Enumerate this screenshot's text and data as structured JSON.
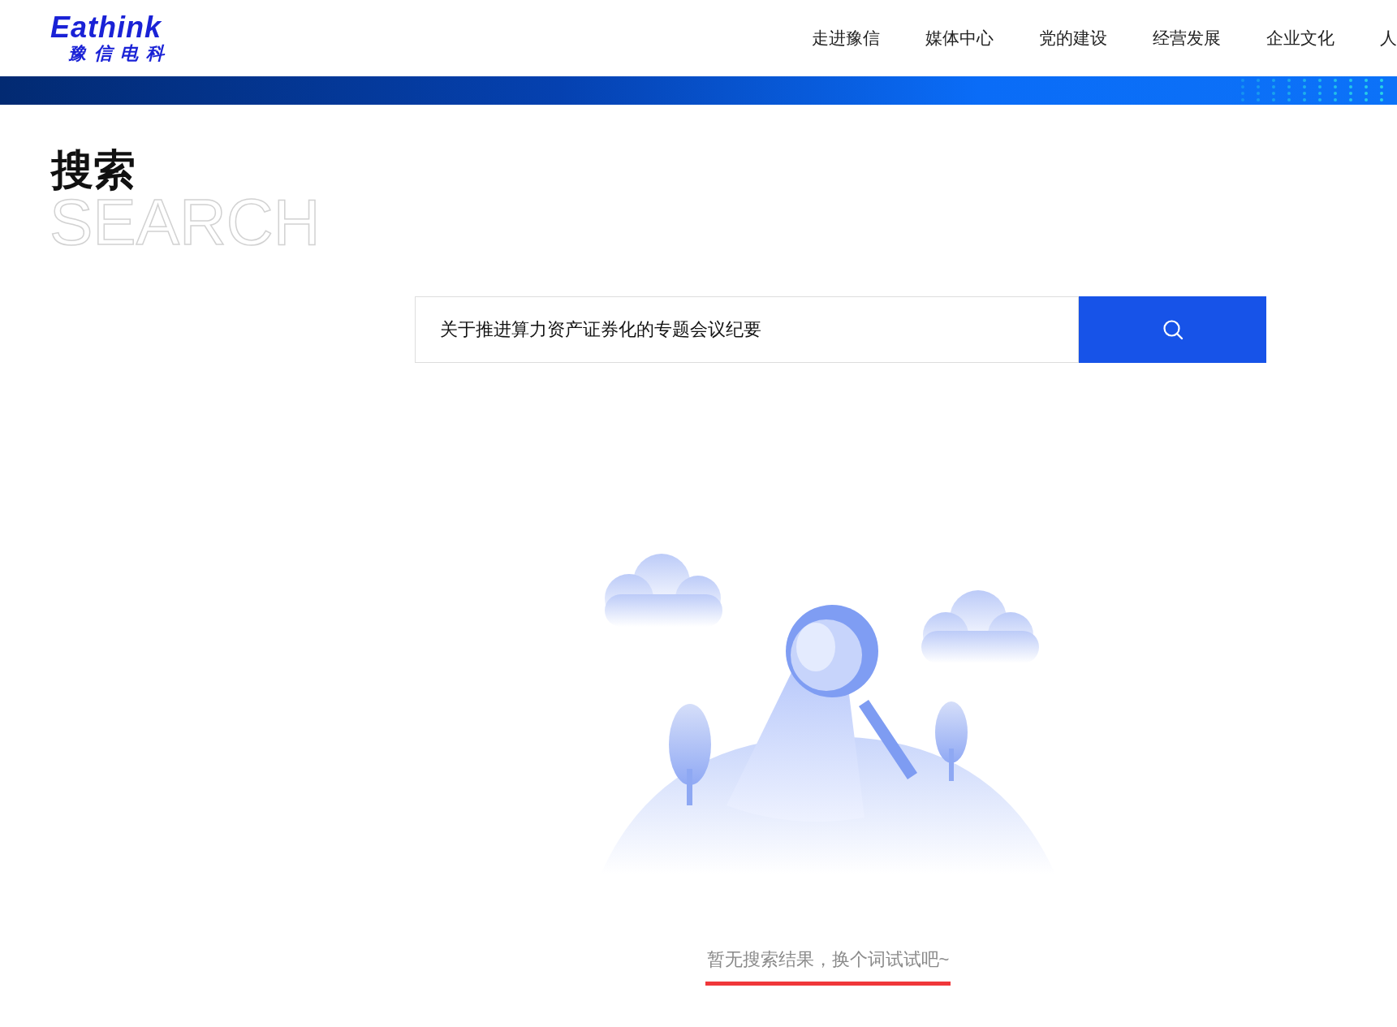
{
  "header": {
    "logo": {
      "wordmark": "Eathink",
      "name": "豫信电科"
    },
    "nav": [
      {
        "label": "走进豫信"
      },
      {
        "label": "媒体中心"
      },
      {
        "label": "党的建设"
      },
      {
        "label": "经营发展"
      },
      {
        "label": "企业文化"
      },
      {
        "label": "人"
      }
    ]
  },
  "page_title": {
    "title": "搜索",
    "background_word": "SEARCH"
  },
  "search": {
    "value": "关于推进算力资产证券化的专题会议纪要"
  },
  "empty_state": {
    "message": "暂无搜索结果，换个词试试吧~"
  }
}
